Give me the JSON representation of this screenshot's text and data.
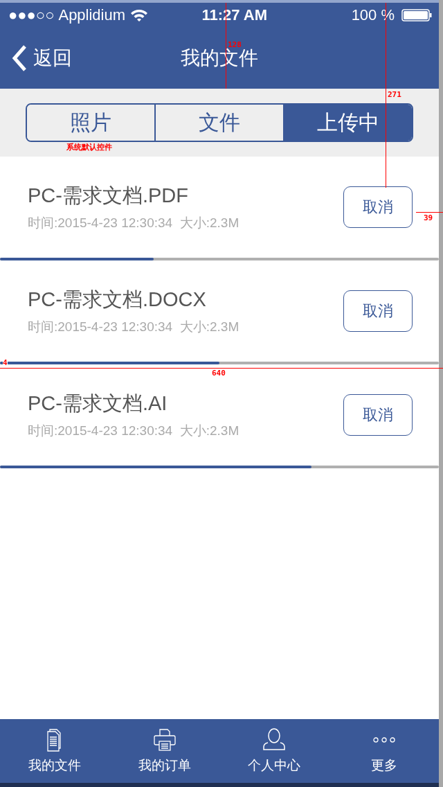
{
  "status_bar": {
    "signal": "●●●○○",
    "carrier": "Applidium",
    "time": "11:27 AM",
    "battery": "100 %"
  },
  "nav": {
    "back": "返回",
    "title": "我的文件"
  },
  "segments": [
    {
      "label": "照片",
      "selected": false
    },
    {
      "label": "文件",
      "selected": false
    },
    {
      "label": "上传中",
      "selected": true
    }
  ],
  "uploads": [
    {
      "name": "PC-需求文档.PDF",
      "meta": "时间:2015-4-23 12:30:34  大小:2.3M",
      "action": "取消",
      "level": 0.35
    },
    {
      "name": "PC-需求文档.DOCX",
      "meta": "时间:2015-4-23 12:30:34  大小:2.3M",
      "action": "取消",
      "level": 0.5
    },
    {
      "name": "PC-需求文档.AI",
      "meta": "时间:2015-4-23 12:30:34  大小:2.3M",
      "action": "取消",
      "level": 0.71
    }
  ],
  "tab_bar": [
    {
      "label": "我的文件",
      "kind": "files"
    },
    {
      "label": "我的订单",
      "kind": "printer"
    },
    {
      "label": "个人中心",
      "kind": "person"
    },
    {
      "label": "更多",
      "kind": "more"
    }
  ],
  "annotations": [
    "128",
    "271",
    "系统默认控件",
    "39",
    "4",
    "640"
  ]
}
